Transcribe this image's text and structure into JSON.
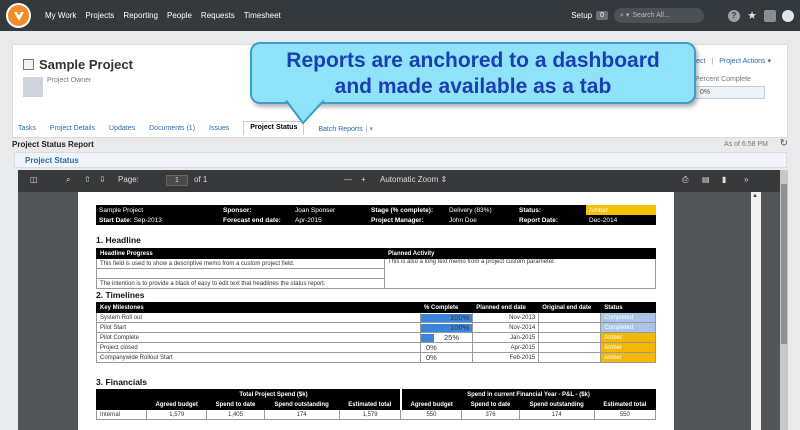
{
  "nav": {
    "links": [
      "My Work",
      "Projects",
      "Reporting",
      "People",
      "Requests",
      "Timesheet"
    ],
    "setup_label": "Setup",
    "setup_badge": "0",
    "search_placeholder": "Search All..."
  },
  "project": {
    "title": "Sample Project",
    "owner_label": "Project Owner",
    "actions_partial": "ject",
    "actions_label": "Project Actions ▾",
    "pct_label": "Percent Complete",
    "pct_value": "0%",
    "tabs": [
      "Tasks",
      "Project Details",
      "Updates",
      "Documents (1)",
      "Issues",
      "Project Status",
      "Batch Reports"
    ]
  },
  "callout": {
    "line1": "Reports are anchored to a dashboard",
    "line2": "and made available as a tab"
  },
  "report": {
    "title": "Project Status Report",
    "as_of": "As of 6:58 PM",
    "section_header": "Project Status"
  },
  "pdf": {
    "page_label": "Page:",
    "page_value": "1",
    "page_of": "of 1",
    "zoom": "Automatic Zoom"
  },
  "doc": {
    "info": {
      "project_name": "Sample Project",
      "sponsor_label": "Sponsor:",
      "sponsor": "Joan Sponser",
      "stage_label": "Stage (% complete):",
      "stage": "Delivery  (83%)",
      "status_label": "Status:",
      "status": "Amber",
      "start_label": "Start Date:",
      "start": "Sep-2013",
      "forecast_label": "Forecast end date:",
      "forecast": "Apr-2015",
      "pm_label": "Project Manager:",
      "pm": "John Doe",
      "report_label": "Report Date:",
      "report_date": "Dec-2014"
    },
    "headline": {
      "title": "1. Headline",
      "progress_header": "Headline Progress",
      "planned_header": "Planned Activity",
      "progress_1": "This field is used to show a descriptive memo from a custom project field.",
      "progress_2": "The intention is to provide a black of easy to edit text that headlines the status report.",
      "planned_1": "This is also a long text memo from a project custom parameter."
    },
    "timelines": {
      "title": "2. Timelines",
      "headers": [
        "Key Milestones",
        "% Complete",
        "Planned end date",
        "Original end date",
        "Status"
      ],
      "rows": [
        {
          "name": "System Roll out",
          "pct": 100,
          "pct_label": "100%",
          "planned": "Nov-2013",
          "original": "",
          "status": "Completed"
        },
        {
          "name": "Pilot Start",
          "pct": 100,
          "pct_label": "100%",
          "planned": "Nov-2014",
          "original": "",
          "status": "Completed"
        },
        {
          "name": "Pilot Complete",
          "pct": 25,
          "pct_label": "25%",
          "planned": "Jan-2015",
          "original": "",
          "status": "Amber"
        },
        {
          "name": "Project closed",
          "pct": 0,
          "pct_label": "0%",
          "planned": "Apr-2015",
          "original": "",
          "status": "Amber"
        },
        {
          "name": "Companywide Rollout Start",
          "pct": 0,
          "pct_label": "0%",
          "planned": "Feb-2015",
          "original": "",
          "status": "Amber"
        }
      ]
    },
    "financials": {
      "title": "3. Financials",
      "group1": "Total Project Spend ($k)",
      "group2": "Spend in current Financial Year - P&L - ($k)",
      "headers": [
        "Agreed budget",
        "Spend to date",
        "Spend outstanding",
        "Estimated total",
        "Agreed budget",
        "Spend to date",
        "Spend outstanding",
        "Estimated total"
      ],
      "rows": [
        {
          "label": "Internal",
          "values": [
            "1,579",
            "1,405",
            "174",
            "1,579",
            "550",
            "376",
            "174",
            "550"
          ]
        }
      ]
    }
  },
  "colors": {
    "nav_bg": "#34393e",
    "accent": "#2a6ab0",
    "amber": "#f5b800",
    "completed": "#a9c4e6",
    "bar": "#3b86dd",
    "callout_bg": "#90e2f8",
    "callout_text": "#1a3fb4"
  }
}
